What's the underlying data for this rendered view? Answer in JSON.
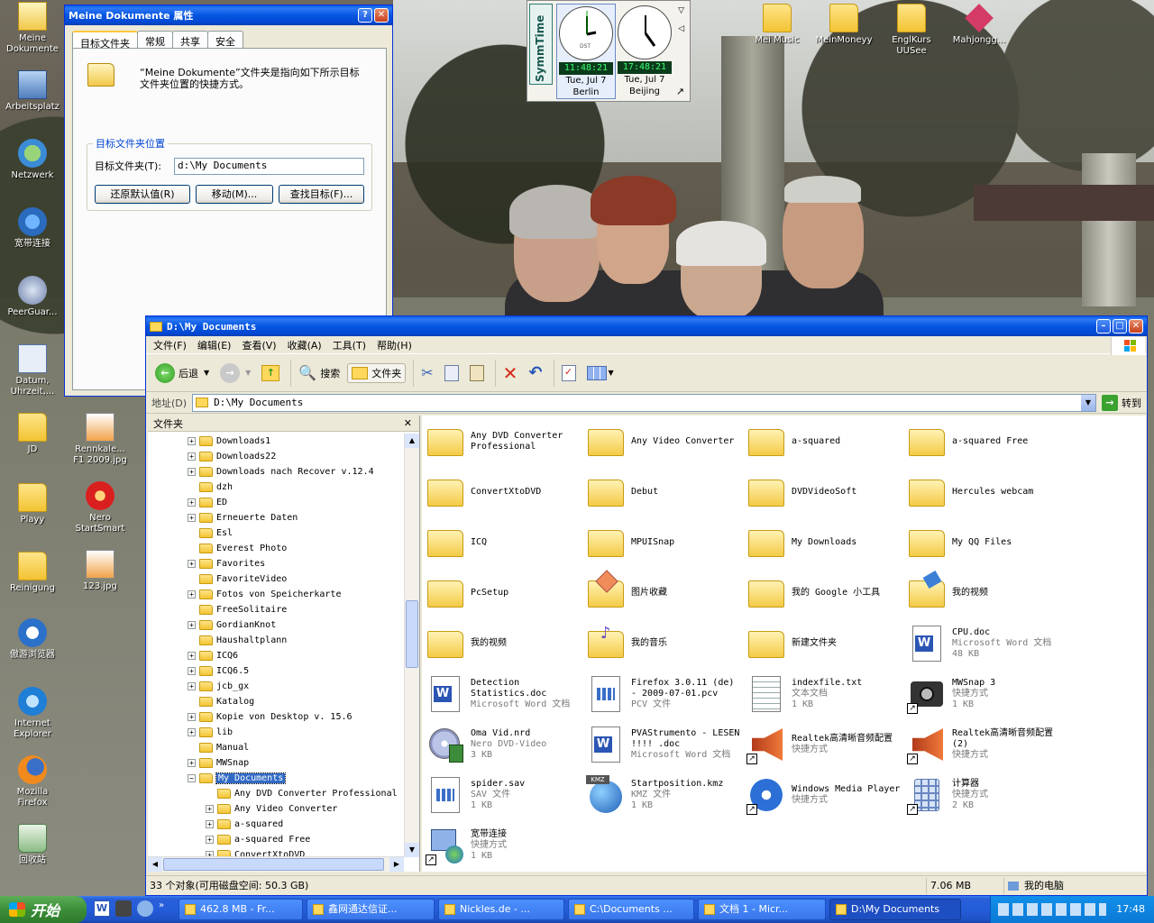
{
  "desktop": {
    "icons": [
      {
        "label": "Meine\nDokumente"
      },
      {
        "label": "Arbeitsplatz"
      },
      {
        "label": "Netzwerk"
      },
      {
        "label": "宽带连接"
      },
      {
        "label": "PeerGuar..."
      },
      {
        "label": "Datum,\nUhrzeit,..."
      },
      {
        "label": "JD"
      },
      {
        "label": "Rennkale...\nF1 2009.jpg"
      },
      {
        "label": "Playy"
      },
      {
        "label": "Nero\nStartSmart"
      },
      {
        "label": "Reinigung"
      },
      {
        "label": "123.jpg"
      },
      {
        "label": "傲游浏览器"
      },
      {
        "label": "Internet\nExplorer"
      },
      {
        "label": "Mozilla\nFirefox"
      },
      {
        "label": "回收站"
      },
      {
        "label": "Mei Music"
      },
      {
        "label": "MeinMoneyy"
      },
      {
        "label": "EnglKurs\nUUSee"
      },
      {
        "label": "Mahjongg..."
      }
    ]
  },
  "clock": {
    "brand": "SymmTime",
    "clocks": [
      {
        "time": "11:48:21",
        "date": "Tue, Jul 7",
        "city": "Berlin",
        "dst": "DST"
      },
      {
        "time": "17:48:21",
        "date": "Tue, Jul 7",
        "city": "Beijing"
      }
    ]
  },
  "props_dialog": {
    "title": "Meine Dokumente 属性",
    "tabs": [
      "目标文件夹",
      "常规",
      "共享",
      "安全"
    ],
    "description": "“Meine Dokumente”文件夹是指向如下所示目标文件夹位置的快捷方式。",
    "group_label": "目标文件夹位置",
    "field_label": "目标文件夹(T):",
    "field_value": "d:\\My Documents",
    "buttons": [
      "还原默认值(R)",
      "移动(M)...",
      "查找目标(F)..."
    ]
  },
  "explorer": {
    "title": "D:\\My Documents",
    "menu": [
      "文件(F)",
      "编辑(E)",
      "查看(V)",
      "收藏(A)",
      "工具(T)",
      "帮助(H)"
    ],
    "toolbar": {
      "back": "后退",
      "search": "搜索",
      "folders": "文件夹"
    },
    "address_label": "地址(D)",
    "address_value": "D:\\My Documents",
    "go_label": "转到",
    "folders_pane_title": "文件夹",
    "tree": [
      {
        "label": "Downloads1",
        "exp": "+",
        "lvl": 0
      },
      {
        "label": "Downloads22",
        "exp": "+",
        "lvl": 0
      },
      {
        "label": "Downloads nach Recover v.12.4",
        "exp": "+",
        "lvl": 0
      },
      {
        "label": "dzh",
        "exp": "",
        "lvl": 0
      },
      {
        "label": "ED",
        "exp": "+",
        "lvl": 0
      },
      {
        "label": "Erneuerte Daten",
        "exp": "+",
        "lvl": 0
      },
      {
        "label": "Esl",
        "exp": "",
        "lvl": 0
      },
      {
        "label": "Everest Photo",
        "exp": "",
        "lvl": 0
      },
      {
        "label": "Favorites",
        "exp": "+",
        "lvl": 0
      },
      {
        "label": "FavoriteVideo",
        "exp": "",
        "lvl": 0
      },
      {
        "label": "Fotos von Speicherkarte",
        "exp": "+",
        "lvl": 0
      },
      {
        "label": "FreeSolitaire",
        "exp": "",
        "lvl": 0
      },
      {
        "label": "GordianKnot",
        "exp": "+",
        "lvl": 0
      },
      {
        "label": "Haushaltplann",
        "exp": "",
        "lvl": 0
      },
      {
        "label": "ICQ6",
        "exp": "+",
        "lvl": 0
      },
      {
        "label": "ICQ6.5",
        "exp": "+",
        "lvl": 0
      },
      {
        "label": "jcb_gx",
        "exp": "+",
        "lvl": 0
      },
      {
        "label": "Katalog",
        "exp": "",
        "lvl": 0
      },
      {
        "label": "Kopie von Desktop v. 15.6",
        "exp": "+",
        "lvl": 0
      },
      {
        "label": "lib",
        "exp": "+",
        "lvl": 0
      },
      {
        "label": "Manual",
        "exp": "",
        "lvl": 0
      },
      {
        "label": "MWSnap",
        "exp": "+",
        "lvl": 0
      },
      {
        "label": "My Documents",
        "exp": "-",
        "lvl": 0,
        "selected": true
      },
      {
        "label": "Any DVD Converter Professional",
        "exp": "",
        "lvl": 1
      },
      {
        "label": "Any Video Converter",
        "exp": "+",
        "lvl": 1
      },
      {
        "label": "a-squared",
        "exp": "+",
        "lvl": 1
      },
      {
        "label": "a-squared Free",
        "exp": "+",
        "lvl": 1
      },
      {
        "label": "ConvertXtoDVD",
        "exp": "+",
        "lvl": 1
      }
    ],
    "items": [
      {
        "name": "Any DVD Converter Professional",
        "type": "folder"
      },
      {
        "name": "Any Video Converter",
        "type": "folder"
      },
      {
        "name": "a-squared",
        "type": "folder"
      },
      {
        "name": "a-squared Free",
        "type": "folder"
      },
      {
        "name": "ConvertXtoDVD",
        "type": "folder"
      },
      {
        "name": "Debut",
        "type": "folder"
      },
      {
        "name": "DVDVideoSoft",
        "type": "folder"
      },
      {
        "name": "Hercules webcam",
        "type": "folder"
      },
      {
        "name": "ICQ",
        "type": "folder"
      },
      {
        "name": "MPUISnap",
        "type": "folder"
      },
      {
        "name": "My Downloads",
        "type": "folder"
      },
      {
        "name": "My QQ Files",
        "type": "folder"
      },
      {
        "name": "PcSetup",
        "type": "folder"
      },
      {
        "name": "图片收藏",
        "type": "pictures"
      },
      {
        "name": "我的 Google 小工具",
        "type": "folder"
      },
      {
        "name": "我的视频",
        "type": "video"
      },
      {
        "name": "我的视频",
        "type": "folder"
      },
      {
        "name": "我的音乐",
        "type": "music"
      },
      {
        "name": "新建文件夹",
        "type": "folder"
      },
      {
        "name": "CPU.doc",
        "desc": "Microsoft Word 文档",
        "size": "48 KB",
        "type": "word"
      },
      {
        "name": "Detection Statistics.doc",
        "desc": "Microsoft Word 文档",
        "type": "word"
      },
      {
        "name": "Firefox 3.0.11 (de) - 2009-07-01.pcv",
        "desc": "PCV 文件",
        "type": "pcv"
      },
      {
        "name": "indexfile.txt",
        "desc": "文本文档",
        "size": "1 KB",
        "type": "txt"
      },
      {
        "name": "MWSnap 3",
        "desc": "快捷方式",
        "size": "1 KB",
        "type": "camera"
      },
      {
        "name": "Oma Vid.nrd",
        "desc": "Nero DVD-Video",
        "size": "3 KB",
        "type": "nero"
      },
      {
        "name": "PVAStrumento - LESEN !!!! .doc",
        "desc": "Microsoft Word 文档",
        "type": "word"
      },
      {
        "name": "Realtek高清晰音频配置",
        "desc": "快捷方式",
        "type": "speaker"
      },
      {
        "name": "Realtek高清晰音频配置 (2)",
        "desc": "快捷方式",
        "type": "speaker"
      },
      {
        "name": "spider.sav",
        "desc": "SAV 文件",
        "size": "1 KB",
        "type": "sav"
      },
      {
        "name": "Startposition.kmz",
        "desc": "KMZ 文件",
        "size": "1 KB",
        "type": "kmz"
      },
      {
        "name": "Windows Media Player",
        "desc": "快捷方式",
        "type": "wmp"
      },
      {
        "name": "计算器",
        "desc": "快捷方式",
        "size": "2 KB",
        "type": "calc"
      },
      {
        "name": "宽带连接",
        "desc": "快捷方式",
        "size": "1 KB",
        "type": "network"
      }
    ],
    "status": {
      "objects": "33 个对象(可用磁盘空间: 50.3 GB)",
      "size": "7.06 MB",
      "location": "我的电脑"
    }
  },
  "taskbar": {
    "start_label": "开始",
    "tasks": [
      {
        "label": "462.8 MB - Fr..."
      },
      {
        "label": "鑫网通达信证..."
      },
      {
        "label": "Nickles.de - ..."
      },
      {
        "label": "C:\\Documents ..."
      },
      {
        "label": "文档 1 - Micr..."
      },
      {
        "label": "D:\\My Documents",
        "active": true
      }
    ],
    "time": "17:48"
  }
}
